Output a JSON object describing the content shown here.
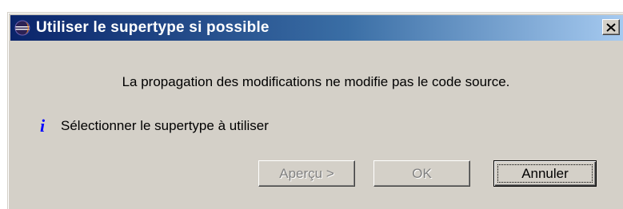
{
  "dialog": {
    "title": "Utiliser le supertype si possible",
    "close_glyph": "✕",
    "message": "La propagation des modifications ne modifie pas le code source.",
    "info_icon": "info-icon",
    "info_glyph": "i",
    "info_text": "Sélectionner le supertype à utiliser"
  },
  "buttons": {
    "preview": {
      "label": "Aperçu >",
      "enabled": false
    },
    "ok": {
      "label": "OK",
      "enabled": false
    },
    "cancel": {
      "label": "Annuler",
      "enabled": true,
      "focused": true
    }
  },
  "colors": {
    "titlebar_start": "#0a246a",
    "titlebar_end": "#a6caf0",
    "dialog_bg": "#d4d0c8",
    "info_icon": "#0000ff",
    "disabled_text": "#808080"
  }
}
